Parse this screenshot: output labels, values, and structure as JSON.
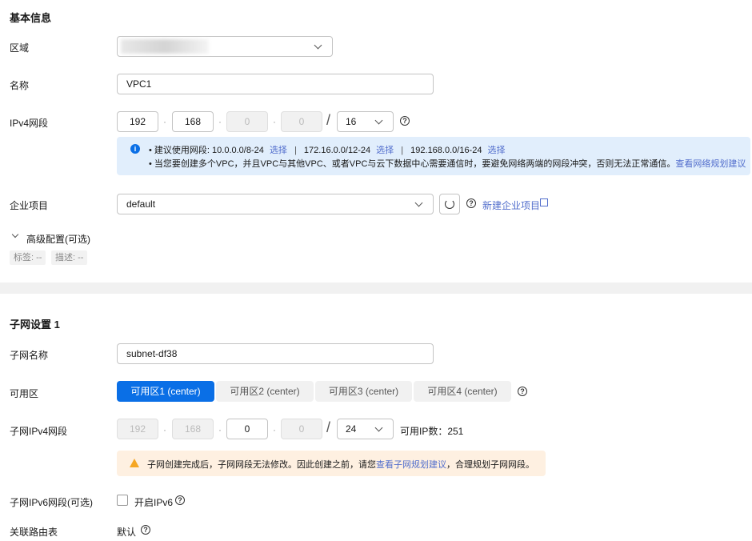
{
  "basic": {
    "title": "基本信息",
    "region": {
      "label": "区域",
      "value": ""
    },
    "name": {
      "label": "名称",
      "value": "VPC1"
    },
    "ipv4": {
      "label": "IPv4网段",
      "o1": "192",
      "o2": "168",
      "o3": "0",
      "o4": "0",
      "sep": "/",
      "mask": "16"
    },
    "info": {
      "line1_prefix": "建议使用网段: 10.0.0.0/8-24",
      "select": "选择",
      "sep": "|",
      "seg2": "172.16.0.0/12-24",
      "seg3": "192.168.0.0/16-24",
      "line2": "当您要创建多个VPC，并且VPC与其他VPC、或者VPC与云下数据中心需要通信时，要避免网络两端的网段冲突，否则无法正常通信。",
      "line2_link": "查看网络规划建议"
    },
    "ep": {
      "label": "企业项目",
      "value": "default",
      "new_link": "新建企业项目"
    },
    "adv": {
      "label": "高级配置(可选)",
      "tag1": "标签: --",
      "tag2": "描述: --"
    }
  },
  "subnet": {
    "title": "子网设置 1",
    "name": {
      "label": "子网名称",
      "value": "subnet-df38"
    },
    "az": {
      "label": "可用区",
      "options": [
        "可用区1 (center)",
        "可用区2 (center)",
        "可用区3 (center)",
        "可用区4 (center)"
      ],
      "selected": 0
    },
    "ipv4": {
      "label": "子网IPv4网段",
      "o1": "192",
      "o2": "168",
      "o3": "0",
      "o4": "0",
      "sep": "/",
      "mask": "24",
      "avail": "可用IP数：251"
    },
    "warn": {
      "text1": "子网创建完成后，子网网段无法修改。因此创建之前，请您",
      "link": "查看子网规划建议",
      "text2": "，合理规划子网网段。"
    },
    "ipv6": {
      "label": "子网IPv6网段(可选)",
      "checkbox": "开启IPv6"
    },
    "route": {
      "label": "关联路由表",
      "value": "默认"
    }
  },
  "colors": {
    "primary": "#0a6fe6",
    "link": "#526ecc",
    "info_bg": "#e1eefc",
    "warn_bg": "#fef0e1",
    "warn_icon": "#f5a623"
  }
}
